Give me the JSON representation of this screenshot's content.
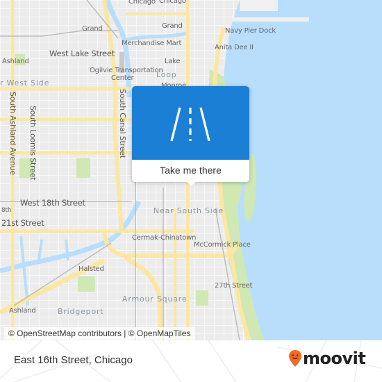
{
  "map": {
    "labels": {
      "chicago1": "Chicago",
      "chicago2": "Chicago",
      "grand_w": "Grand",
      "grand_e": "Grand",
      "navy_pier": "Navy Pier Dock",
      "merchandise_mart": "Merchandise Mart",
      "anita_dee": "Anita Dee II",
      "west_lake": "West Lake Street",
      "ashland_n": "Ashland",
      "ogilvie": "Ogilvie Transportation",
      "ogilvie2": "Center",
      "lake": "Lake",
      "loop": "Loop",
      "monroe": "Monroe",
      "west_side": "r West Side",
      "south_ashland": "South Ashland Avenue",
      "south_loomis": "South Loomis Street",
      "south_canal": "South Canal Street",
      "west_18th": "West 18th Street",
      "eighth": "8th",
      "st21": "21st Street",
      "near_south": "Near South Side",
      "cermak": "Cermak-Chinatown",
      "mccormick": "McCormick Place",
      "halsted": "Halsted",
      "st27": "27th Street",
      "armour": "Armour Square",
      "ashland_s": "Ashland",
      "bridgeport": "Bridgeport"
    },
    "attribution": "© OpenStreetMap contributors | © OpenMapTiles",
    "colors": {
      "water": "#b8defc",
      "park": "#cfe8b4",
      "major_road": "#fbe7a3",
      "land": "#efefef"
    }
  },
  "popup": {
    "icon": "road-icon",
    "label": "Take me there",
    "color": "#1c7fd6"
  },
  "footer": {
    "place": "East 16th Street, Chicago",
    "brand": "moovit",
    "brand_color": "#f26a21"
  }
}
